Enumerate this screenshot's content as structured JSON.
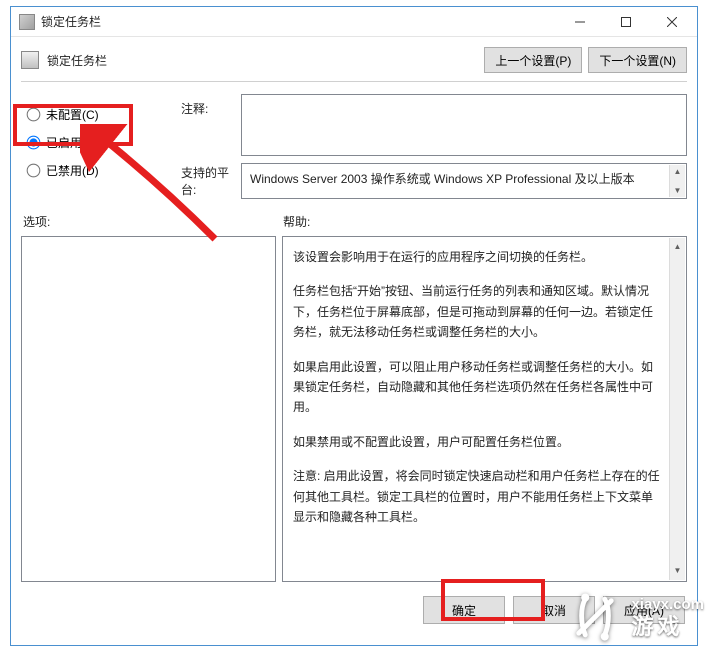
{
  "window": {
    "title": "锁定任务栏"
  },
  "header": {
    "title": "锁定任务栏",
    "prev_btn": "上一个设置(P)",
    "next_btn": "下一个设置(N)"
  },
  "radios": {
    "not_configured": "未配置(C)",
    "enabled": "已启用(E)",
    "disabled": "已禁用(D)",
    "selected": "enabled"
  },
  "labels": {
    "comment": "注释:",
    "platform": "支持的平台:",
    "options": "选项:",
    "help": "帮助:"
  },
  "fields": {
    "comment_value": "",
    "platform_value": "Windows Server 2003 操作系统或 Windows XP Professional 及以上版本"
  },
  "help": {
    "p1": "该设置会影响用于在运行的应用程序之间切换的任务栏。",
    "p2": "任务栏包括“开始”按钮、当前运行任务的列表和通知区域。默认情况下，任务栏位于屏幕底部，但是可拖动到屏幕的任何一边。若锁定任务栏，就无法移动任务栏或调整任务栏的大小。",
    "p3": "如果启用此设置，可以阻止用户移动任务栏或调整任务栏的大小。如果锁定任务栏，自动隐藏和其他任务栏选项仍然在任务栏各属性中可用。",
    "p4": "如果禁用或不配置此设置，用户可配置任务栏位置。",
    "p5": "注意: 启用此设置，将会同时锁定快速启动栏和用户任务栏上存在的任何其他工具栏。锁定工具栏的位置时，用户不能用任务栏上下文菜单显示和隐藏各种工具栏。"
  },
  "footer": {
    "ok": "确定",
    "cancel": "取消",
    "apply": "应用(A)"
  },
  "watermark": {
    "url": "xiayx.com",
    "name": "游戏"
  },
  "chart_data": null
}
